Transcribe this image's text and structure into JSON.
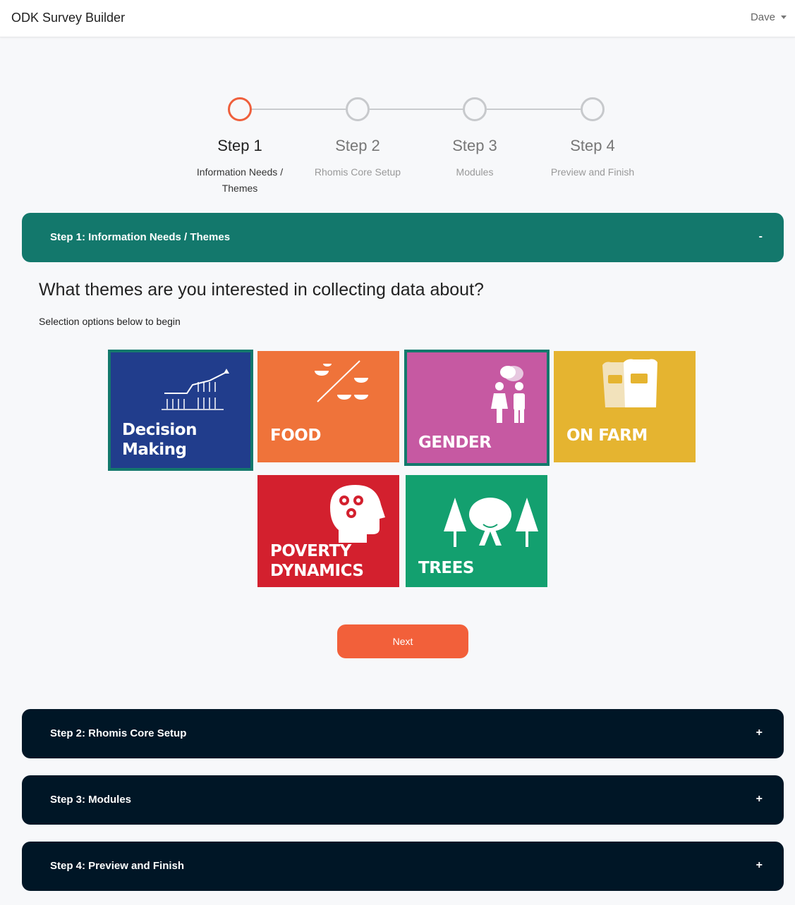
{
  "app": {
    "title": "ODK Survey Builder",
    "user": "Dave"
  },
  "stepper": {
    "steps": [
      {
        "title": "Step 1",
        "subtitle": "Information Needs / Themes",
        "active": true
      },
      {
        "title": "Step 2",
        "subtitle": "Rhomis Core Setup",
        "active": false
      },
      {
        "title": "Step 3",
        "subtitle": "Modules",
        "active": false
      },
      {
        "title": "Step 4",
        "subtitle": "Preview and Finish",
        "active": false
      }
    ]
  },
  "sections": [
    {
      "label": "Step 1: Information Needs / Themes",
      "toggle": "-"
    },
    {
      "label": "Step 2: Rhomis Core Setup",
      "toggle": "+"
    },
    {
      "label": "Step 3: Modules",
      "toggle": "+"
    },
    {
      "label": "Step 4: Preview and Finish",
      "toggle": "+"
    }
  ],
  "themes_panel": {
    "question": "What themes are you interested in collecting data about?",
    "hint": "Selection options below to begin",
    "tiles": [
      {
        "line1": "Decision",
        "line2": "Making",
        "color": "#213d8c",
        "selected": true,
        "icon": "rising-chart-crops-icon"
      },
      {
        "line1": "FOOD",
        "line2": "",
        "color": "#ef733a",
        "selected": false,
        "icon": "bowls-scale-icon"
      },
      {
        "line1": "GENDER",
        "line2": "",
        "color": "#c659a2",
        "selected": true,
        "icon": "man-woman-icon"
      },
      {
        "line1": "ON FARM",
        "line2": "",
        "color": "#e5b430",
        "selected": false,
        "icon": "feed-sacks-icon"
      },
      {
        "line1": "POVERTY",
        "line2": "DYNAMICS",
        "color": "#d3202e",
        "selected": false,
        "icon": "head-gears-icon"
      },
      {
        "line1": "TREES",
        "line2": "",
        "color": "#13a06f",
        "selected": false,
        "icon": "trees-icon"
      }
    ],
    "next_label": "Next"
  },
  "colors": {
    "accent_orange": "#f2603a",
    "section_open": "#13786c",
    "section_closed": "#001626"
  }
}
